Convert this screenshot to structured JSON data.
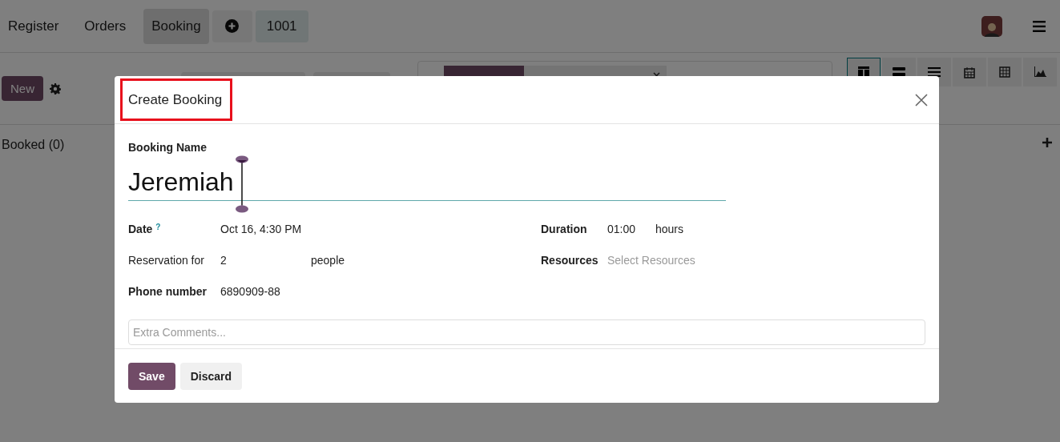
{
  "nav": {
    "items": [
      {
        "label": "Register",
        "selected": false
      },
      {
        "label": "Orders",
        "selected": false
      },
      {
        "label": "Booking",
        "selected": true
      }
    ],
    "order_number": "1001"
  },
  "control_panel": {
    "new_button": "New",
    "facets": [
      {
        "kind": "group"
      },
      {
        "kind": "value"
      }
    ],
    "views": [
      {
        "kind": "kanban",
        "selected": true
      },
      {
        "kind": "gantt",
        "selected": false
      },
      {
        "kind": "list",
        "selected": false
      },
      {
        "kind": "calendar",
        "selected": false
      },
      {
        "kind": "pivot",
        "selected": false
      },
      {
        "kind": "graph",
        "selected": false
      }
    ]
  },
  "column": {
    "title": "Booked (0)"
  },
  "dialog": {
    "title": "Create Booking",
    "title_highlighted": true,
    "name_field": {
      "label": "Booking Name",
      "value": "Jeremiah"
    },
    "left_fields": [
      {
        "label": "Date",
        "bold": true,
        "help": "?",
        "value": "Oct 16, 4:30 PM"
      },
      {
        "label": "Reservation for",
        "bold": false,
        "value": "2",
        "unit": "people"
      },
      {
        "label": "Phone number",
        "bold": true,
        "value": "6890909-88"
      }
    ],
    "right_fields": [
      {
        "label": "Duration",
        "value": "01:00",
        "unit": "hours"
      },
      {
        "label": "Resources",
        "placeholder": "Select Resources"
      }
    ],
    "comments": {
      "placeholder": "Extra Comments..."
    },
    "buttons": [
      {
        "label": "Save",
        "kind": "primary"
      },
      {
        "label": "Discard",
        "kind": "secondary"
      }
    ]
  }
}
